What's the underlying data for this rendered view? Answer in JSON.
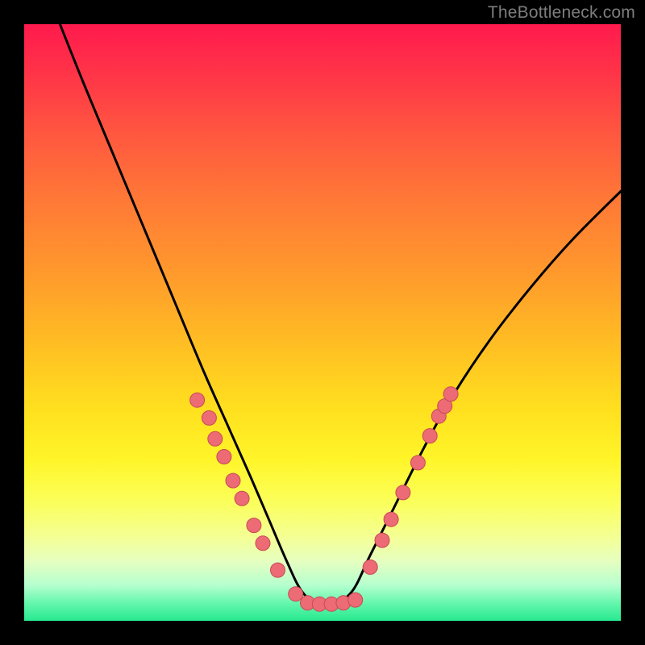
{
  "watermark": "TheBottleneck.com",
  "colors": {
    "frame": "#000000",
    "curve_stroke": "#000000",
    "dot_fill": "#ec6b75",
    "dot_stroke": "#c84a56"
  },
  "chart_data": {
    "type": "line",
    "title": "",
    "xlabel": "",
    "ylabel": "",
    "xlim": [
      0,
      1
    ],
    "ylim": [
      0,
      1
    ],
    "note": "No axes, ticks, or numeric labels are rendered. x in [0,1] left→right, y in [0,1] bottom→top. Values are visual estimates from pixel positions.",
    "series": [
      {
        "name": "curve",
        "style": "line",
        "x": [
          0.06,
          0.1,
          0.15,
          0.2,
          0.25,
          0.3,
          0.34,
          0.38,
          0.41,
          0.44,
          0.465,
          0.49,
          0.52,
          0.55,
          0.58,
          0.62,
          0.67,
          0.72,
          0.78,
          0.85,
          0.92,
          1.0
        ],
        "y": [
          1.0,
          0.9,
          0.78,
          0.66,
          0.54,
          0.42,
          0.33,
          0.24,
          0.17,
          0.1,
          0.05,
          0.03,
          0.03,
          0.05,
          0.11,
          0.19,
          0.29,
          0.38,
          0.47,
          0.56,
          0.64,
          0.72
        ]
      },
      {
        "name": "left-cluster-dots",
        "style": "scatter",
        "x": [
          0.29,
          0.31,
          0.32,
          0.335,
          0.35,
          0.365,
          0.385,
          0.4,
          0.425,
          0.455
        ],
        "y": [
          0.37,
          0.34,
          0.305,
          0.275,
          0.235,
          0.205,
          0.16,
          0.13,
          0.085,
          0.045
        ]
      },
      {
        "name": "bottom-dots",
        "style": "scatter",
        "x": [
          0.475,
          0.495,
          0.515,
          0.535,
          0.555
        ],
        "y": [
          0.03,
          0.028,
          0.028,
          0.03,
          0.035
        ]
      },
      {
        "name": "right-cluster-dots",
        "style": "scatter",
        "x": [
          0.58,
          0.6,
          0.615,
          0.635,
          0.66,
          0.68,
          0.695,
          0.705,
          0.715
        ],
        "y": [
          0.09,
          0.135,
          0.17,
          0.215,
          0.265,
          0.31,
          0.343,
          0.36,
          0.38
        ]
      }
    ]
  }
}
